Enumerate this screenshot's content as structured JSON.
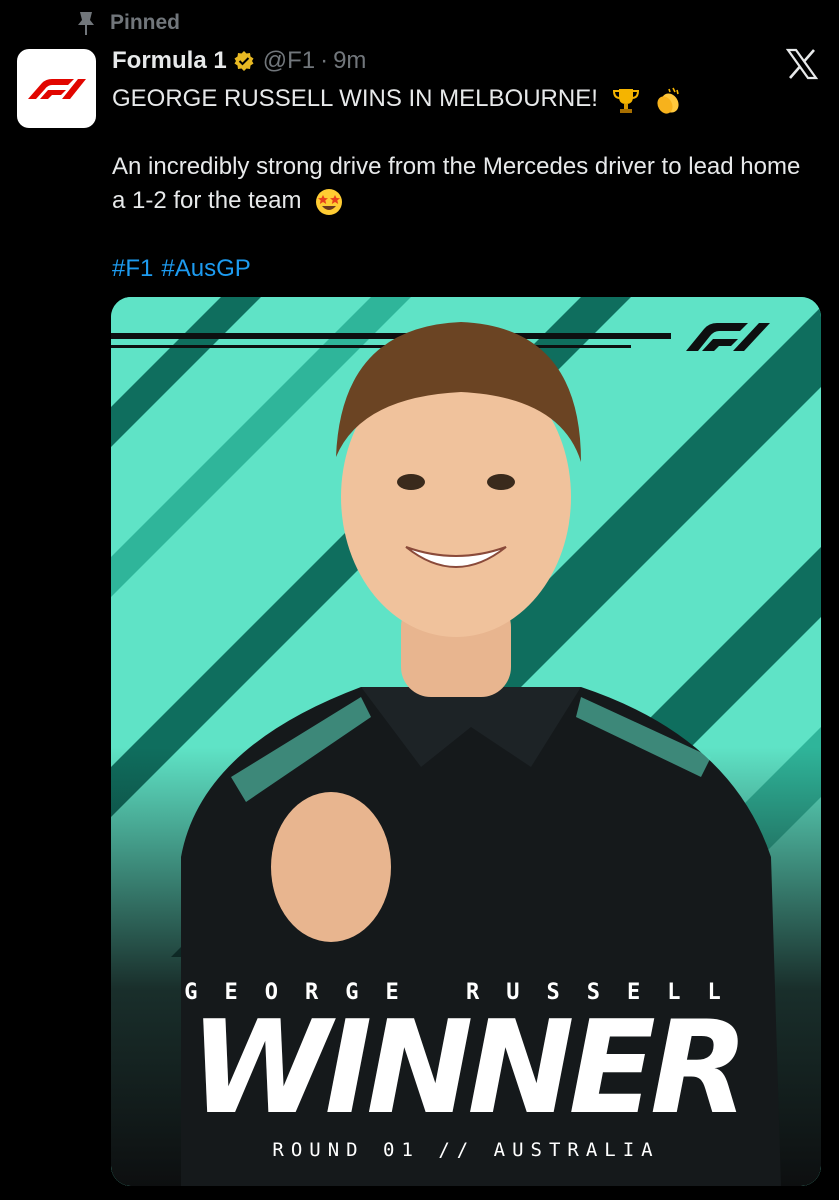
{
  "pinned": {
    "label": "Pinned",
    "icon": "pin-icon"
  },
  "author": {
    "display_name": "Formula 1",
    "handle": "@F1",
    "separator": "·",
    "time": "9m",
    "avatar_icon": "f1-logo-icon",
    "verified_icon": "verified-badge-icon"
  },
  "platform_icon": "x-logo-icon",
  "tweet": {
    "headline": "GEORGE RUSSELL WINS IN MELBOURNE!",
    "headline_emojis": [
      "trophy-emoji",
      "clapping-hands-emoji"
    ],
    "body": "An incredibly strong drive from the Mercedes driver to lead home a 1-2 for the team",
    "body_emoji": "star-struck-emoji",
    "hashtags": [
      "#F1",
      "#AusGP"
    ]
  },
  "media": {
    "driver_name": "GEORGE RUSSELL",
    "title": "WINNER",
    "round_line": "ROUND 01  //  AUSTRALIA",
    "colors": {
      "teal": "#5fe3c6",
      "dark": "#0d0f10",
      "accent_blue": "#1d9bf0",
      "f1_red": "#e10600"
    }
  }
}
